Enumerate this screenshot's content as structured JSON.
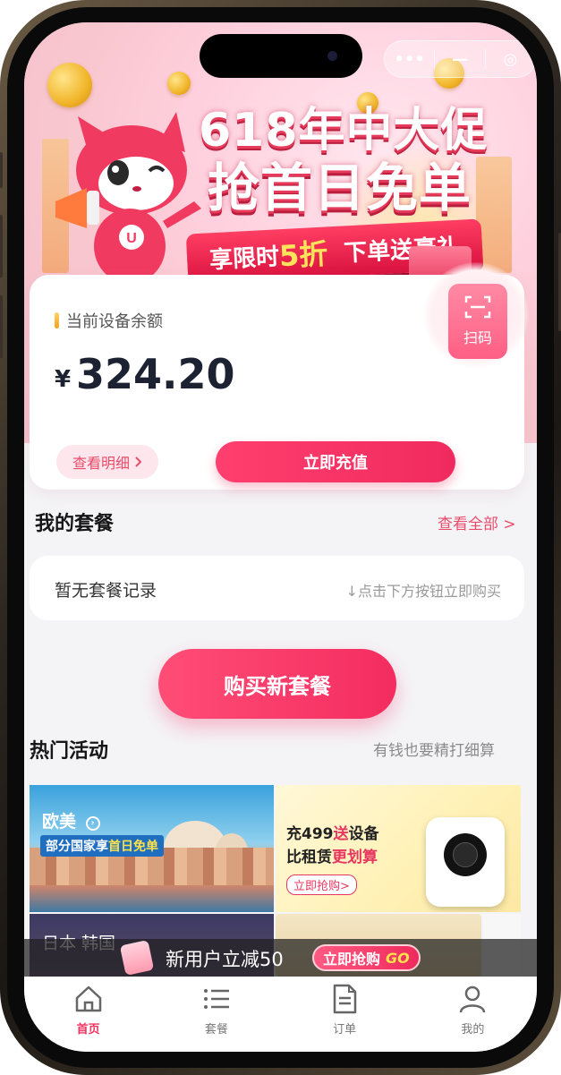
{
  "banner": {
    "title_line1": "618年中大促",
    "title_line2": "抢首日免单",
    "ribbon_pre": "享限时",
    "ribbon_highlight": "5折",
    "ribbon_post": "下单送豪礼"
  },
  "capsule": {
    "more": "•••",
    "minimize": "—",
    "close": "◎"
  },
  "balance": {
    "label": "当前设备余额",
    "currency": "¥",
    "amount": "324.20",
    "scan_label": "扫码",
    "detail_label": "查看明细",
    "recharge_label": "立即充值"
  },
  "packages": {
    "title": "我的套餐",
    "view_all": "查看全部 >",
    "empty_text": "暂无套餐记录",
    "hint": "↓点击下方按钮立即购买",
    "buy_label": "购买新套餐"
  },
  "activities": {
    "title": "热门活动",
    "subtitle": "有钱也要精打细算",
    "items": [
      {
        "region": "欧美",
        "line_pre": "部分国家享",
        "line_highlight": "首日免单"
      },
      {
        "line1_pre": "充499",
        "line1_red": "送",
        "line1_post": "设备",
        "line2_pre": "比租赁",
        "line2_red": "更划算",
        "cta": "立即抢购>"
      },
      {
        "region": "日本 韩国"
      }
    ]
  },
  "promo": {
    "text": "新用户立减50",
    "button": "立即抢购",
    "go": "GO"
  },
  "tabs": [
    {
      "label": "首页",
      "icon": "home-icon",
      "active": true
    },
    {
      "label": "套餐",
      "icon": "list-icon",
      "active": false
    },
    {
      "label": "订单",
      "icon": "document-icon",
      "active": false
    },
    {
      "label": "我的",
      "icon": "user-icon",
      "active": false
    }
  ],
  "colors": {
    "accent": "#f0335f",
    "active_tab": "#f0335f"
  }
}
